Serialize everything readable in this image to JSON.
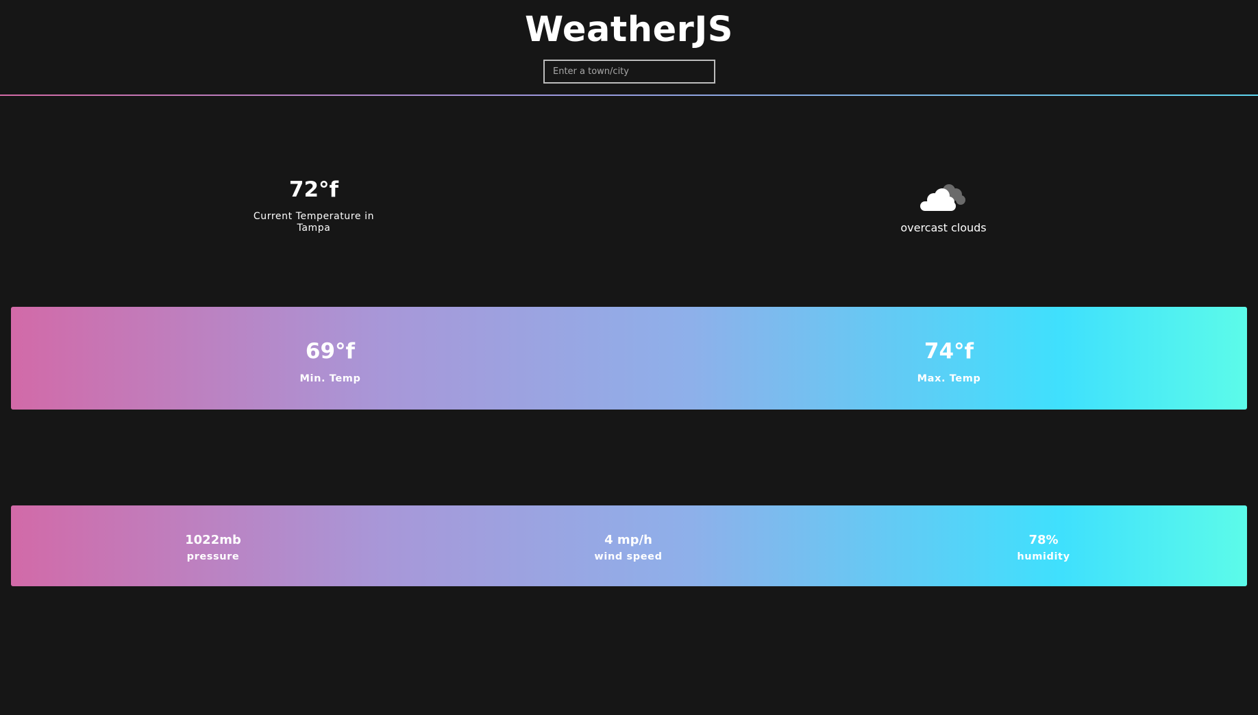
{
  "header": {
    "title": "WeatherJS",
    "search_placeholder": "Enter a town/city"
  },
  "current": {
    "temperature": "72°f",
    "label": "Current Temperature in Tampa",
    "condition": "overcast clouds",
    "condition_icon": "cloud-icon"
  },
  "range": {
    "min_value": "69°f",
    "min_label": "Min. Temp",
    "max_value": "74°f",
    "max_label": "Max. Temp"
  },
  "stats": {
    "pressure_value": "1022mb",
    "pressure_label": "pressure",
    "wind_value": "4 mp/h",
    "wind_label": "wind speed",
    "humidity_value": "78%",
    "humidity_label": "humidity"
  },
  "colors": {
    "background": "#161616",
    "gradient_start": "#d26aa8",
    "gradient_end": "#5cfbe9"
  }
}
